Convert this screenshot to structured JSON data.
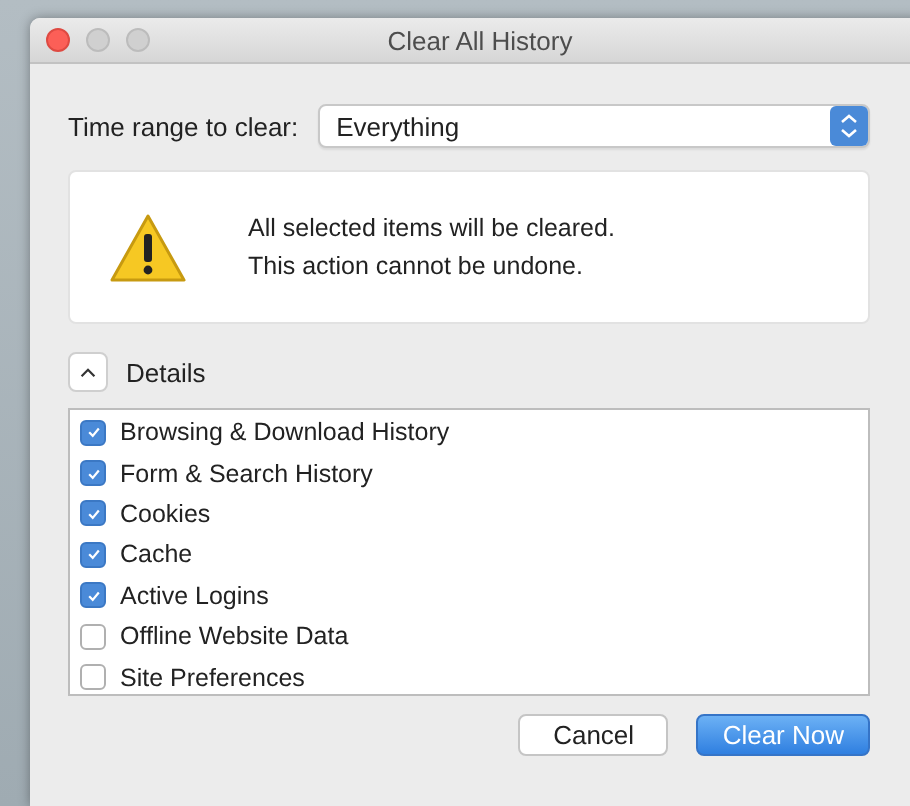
{
  "window": {
    "title": "Clear All History"
  },
  "time_range": {
    "label": "Time range to clear:",
    "value": "Everything"
  },
  "warning": {
    "lines": [
      "All selected items will be cleared.",
      "This action cannot be undone."
    ]
  },
  "details": {
    "label": "Details",
    "expanded": true
  },
  "items": [
    {
      "label": "Browsing & Download History",
      "checked": true
    },
    {
      "label": "Form & Search History",
      "checked": true
    },
    {
      "label": "Cookies",
      "checked": true
    },
    {
      "label": "Cache",
      "checked": true
    },
    {
      "label": "Active Logins",
      "checked": true
    },
    {
      "label": "Offline Website Data",
      "checked": false
    },
    {
      "label": "Site Preferences",
      "checked": false
    }
  ],
  "buttons": [
    {
      "label": "Cancel",
      "kind": "secondary"
    },
    {
      "label": "Clear Now",
      "kind": "primary"
    }
  ]
}
